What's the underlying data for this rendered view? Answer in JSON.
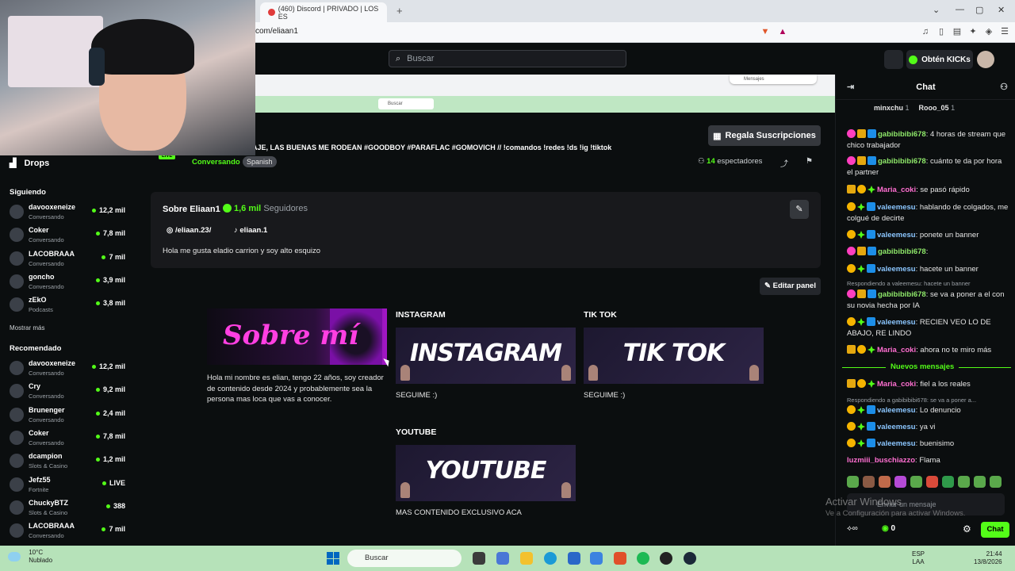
{
  "browser": {
    "tab_title": "(460) Discord | PRIVADO | LOS ES",
    "url": "com/eliaan1"
  },
  "header": {
    "search_placeholder": "Buscar",
    "kicks_button": "Obtén KICKs"
  },
  "sidebar": {
    "drops_label": "Drops",
    "following_label": "Siguiendo",
    "show_more": "Mostrar más",
    "recommended_label": "Recomendado",
    "following": [
      {
        "name": "davooxeneize",
        "category": "Conversando",
        "viewers": "12,2 mil"
      },
      {
        "name": "Coker",
        "category": "Conversando",
        "viewers": "7,8 mil"
      },
      {
        "name": "LACOBRAAA",
        "category": "Conversando",
        "viewers": "7 mil"
      },
      {
        "name": "goncho",
        "category": "Conversando",
        "viewers": "3,9 mil"
      },
      {
        "name": "zEkO",
        "category": "Podcasts",
        "viewers": "3,8 mil"
      }
    ],
    "recommended": [
      {
        "name": "davooxeneize",
        "category": "Conversando",
        "viewers": "12,2 mil"
      },
      {
        "name": "Cry",
        "category": "Conversando",
        "viewers": "9,2 mil"
      },
      {
        "name": "Brunenger",
        "category": "Conversando",
        "viewers": "2,4 mil"
      },
      {
        "name": "Coker",
        "category": "Conversando",
        "viewers": "7,8 mil"
      },
      {
        "name": "dcampion",
        "category": "Slots & Casino",
        "viewers": "1,2 mil"
      },
      {
        "name": "Jefz55",
        "category": "Fortnite",
        "viewers": "LIVE"
      },
      {
        "name": "ChuckyBTZ",
        "category": "Slots & Casino",
        "viewers": "388"
      },
      {
        "name": "LACOBRAAA",
        "category": "Conversando",
        "viewers": "7 mil"
      }
    ]
  },
  "player": {
    "taskbar_search": "Buscar",
    "notif_pill": "Mensajes"
  },
  "stream": {
    "title": "AJE, LAS BUENAS ME RODEAN #GOODBOY #PARAFLAC #GOMOVICH // !comandos !redes !ds !ig !tiktok",
    "live_badge": "LIVE",
    "category": "Conversando",
    "language": "Spanish",
    "viewers_count": "14",
    "viewers_label": "espectadores",
    "gift_subs_button": "Regala Suscripciones"
  },
  "about": {
    "title": "Sobre Eliaan1",
    "followers_count": "1,6 mil",
    "followers_label": "Seguidores",
    "instagram": "/eliaan.23/",
    "tiktok": "eliaan.1",
    "bio": "Hola me gusta eladio carrion y soy alto esquizo",
    "edit_panel": "Editar panel"
  },
  "panels": {
    "sobre_image_text": "Sobre mí",
    "sobre_desc": "Hola mi nombre es elian, tengo 22 años, soy creador de contenido desde 2024 y probablemente sea la persona mas loca que vas a conocer.",
    "instagram_title": "INSTAGRAM",
    "instagram_image_text": "INSTAGRAM",
    "instagram_desc": "SEGUIME :)",
    "tiktok_title": "TIK TOK",
    "tiktok_image_text": "TIK TOK",
    "tiktok_desc": "SEGUIME :)",
    "youtube_title": "YOUTUBE",
    "youtube_image_text": "YOUTUBE",
    "youtube_desc": "MAS CONTENIDO EXCLUSIVO ACA"
  },
  "chat": {
    "title": "Chat",
    "top_gifters": [
      {
        "name": "minxchu",
        "count": "1"
      },
      {
        "name": "Rooo_05",
        "count": "1"
      }
    ],
    "messages": [
      {
        "user": "gabibibibi678",
        "text": "4 horas de stream que chico trabajador"
      },
      {
        "user": "gabibibibi678",
        "text": "cuánto te da por hora el partner"
      },
      {
        "user": "Maria_coki",
        "text": "se pasó rápido"
      },
      {
        "user": "valeemesu",
        "text": "hablando de colgados, me colgué de decirte"
      },
      {
        "user": "valeemesu",
        "text": "ponete un banner"
      },
      {
        "user": "gabibibibi678",
        "text": ""
      },
      {
        "user": "valeemesu",
        "text": "hacete un banner"
      },
      {
        "user": "gabibibibi678",
        "text": "se va a poner a el con su novia hecha por IA"
      },
      {
        "user": "valeemesu",
        "text": "RECIEN VEO LO DE ABAJO, RE LINDO"
      },
      {
        "user": "Maria_coki",
        "text": "ahora no te miro más"
      },
      {
        "user": "Maria_coki",
        "text": "fiel a los reales"
      },
      {
        "user": "valeemesu",
        "text": "Lo denuncio"
      },
      {
        "user": "valeemesu",
        "text": "ya vi"
      },
      {
        "user": "valeemesu",
        "text": "buenisimo"
      },
      {
        "user": "luzmiii_buschiazzo",
        "text": "Flama"
      }
    ],
    "reply1": "Respondiendo a valeemesu: hacete un banner",
    "reply2": "Respondiendo a gabibibibi678: se va a poner a...",
    "new_messages": "Nuevos mensajes",
    "input_placeholder": "Enviar un mensaje",
    "kicks_count": "0",
    "send_button": "Chat"
  },
  "windows": {
    "activate_title": "Activar Windows",
    "activate_sub": "Ve a Configuración para activar Windows.",
    "weather_temp": "10°C",
    "weather_desc": "Nublado",
    "search": "Buscar",
    "lang1": "ESP",
    "lang2": "LAA",
    "time": "21:44",
    "date": "13/8/2026"
  },
  "colors": {
    "kick_green": "#53fc18",
    "background": "#0b0e0f"
  }
}
